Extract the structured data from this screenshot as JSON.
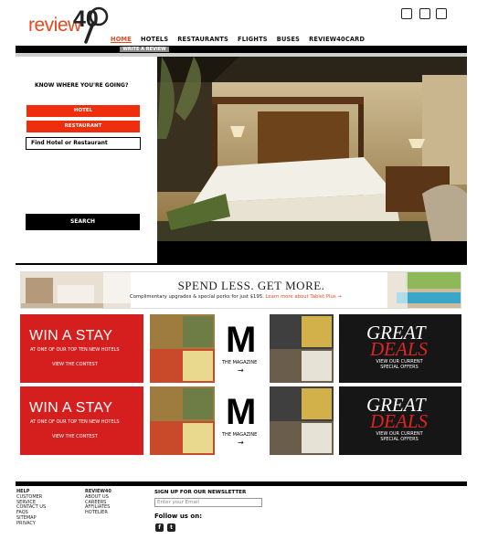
{
  "header": {
    "logo_text": "review",
    "logo_num": "40",
    "nav": [
      "HOME",
      "HOTELS",
      "RESTAURANTS",
      "FLIGHTS",
      "BUSES",
      "REVIEW40CARD"
    ],
    "icons": [
      "tv-icon",
      "phone-icon",
      "mail-icon"
    ]
  },
  "subnav": {
    "write_review": "WRITE A REVIEW"
  },
  "search_panel": {
    "heading": "KNOW WHERE YOU'RE GOING?",
    "hotel_button": "HOTEL",
    "restaurant_button": "RESTAURANT",
    "find_placeholder": "Find Hotel or Restaurant",
    "search_button": "SEARCH"
  },
  "banner": {
    "title": "SPEND LESS. GET MORE.",
    "subtitle": "Complimentary upgrades & special perks for just $195.",
    "link": "Learn more about Tablet Plus →"
  },
  "promos": {
    "win_title": "WIN A STAY",
    "win_sub": "AT ONE OF OUR TOP TEN NEW HOTELS",
    "win_link": "VIEW THE CONTEST",
    "mag_letter": "M",
    "mag_label": "THE MAGAZINE",
    "great_1": "GREAT",
    "great_2": "DEALS",
    "great_sub": "VIEW OUR CURRENT SPECIAL OFFERS"
  },
  "footer": {
    "help_head": "HELP",
    "help_items": [
      "CUSTOMER",
      "SERVICE",
      "CONTACT US",
      "FAQS",
      "SITEMAP",
      "PRIVACY"
    ],
    "r40_head": "REVIEW40",
    "r40_items": [
      "ABOUT US",
      "CAREERS",
      "AFFILIATES",
      "HOTELIER"
    ],
    "newsletter": "SIGN UP FOR OUR NEWSLETTER",
    "email_placeholder": "Enter your Email",
    "follow": "Follow us on:",
    "social": [
      "facebook-icon",
      "twitter-icon"
    ]
  }
}
